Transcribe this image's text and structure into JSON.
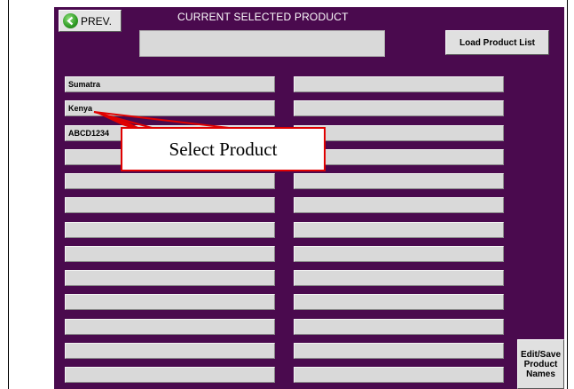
{
  "header": {
    "prev_label": "PREV.",
    "current_title": "CURRENT SELECTED PRODUCT",
    "current_value": "",
    "load_label": "Load Product List"
  },
  "products_left": [
    "Sumatra",
    "Kenya",
    "ABCD1234",
    "",
    "",
    "",
    "",
    "",
    "",
    "",
    "",
    "",
    ""
  ],
  "products_right": [
    "",
    "",
    "",
    "",
    "",
    "",
    "",
    "",
    "",
    "",
    "",
    "",
    ""
  ],
  "edit_button": {
    "line1": "Edit/Save",
    "line2": "Product",
    "line3": "Names"
  },
  "callout": {
    "text": "Select Product"
  },
  "colors": {
    "panel": "#4a0a4e",
    "callout_border": "#e00000"
  }
}
